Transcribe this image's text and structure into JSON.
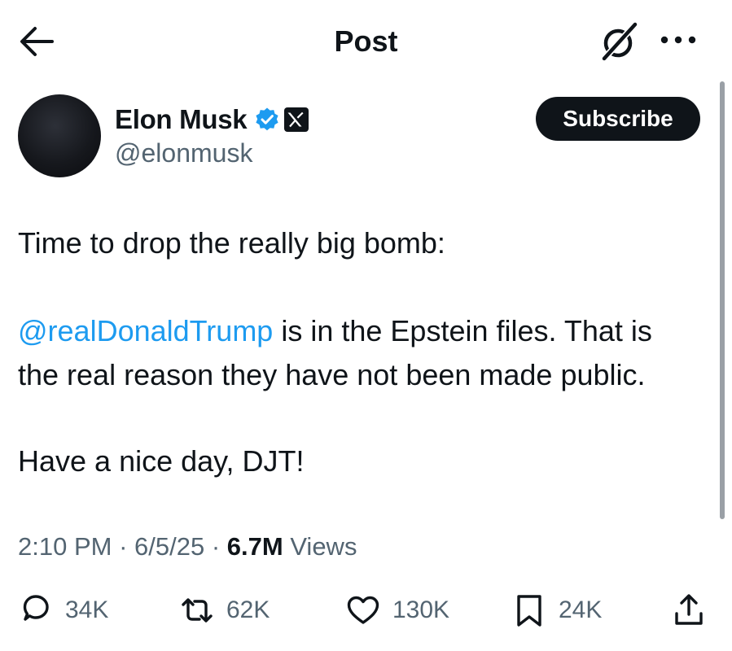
{
  "header": {
    "title": "Post",
    "back_icon": "arrow-left-icon",
    "grok_icon": "grok-icon",
    "more_icon": "more-horizontal-icon"
  },
  "author": {
    "name": "Elon Musk",
    "handle": "@elonmusk",
    "verified_icon": "verified-badge-icon",
    "affiliate_icon": "x-logo-badge-icon",
    "subscribe_label": "Subscribe"
  },
  "post": {
    "line1": "Time to drop the really big bomb:",
    "mention": "@realDonaldTrump",
    "line2_rest": " is in the Epstein files. That is",
    "line3": "the real reason they have not been made public.",
    "line4": "Have a nice day, DJT!"
  },
  "meta": {
    "time": "2:10 PM",
    "sep1": " · ",
    "date": "6/5/25",
    "sep2": " · ",
    "views": "6.7M",
    "views_label": " Views"
  },
  "actions": {
    "replies": "34K",
    "reposts": "62K",
    "likes": "130K",
    "bookmarks": "24K"
  },
  "colors": {
    "text": "#0f1419",
    "secondary": "#536471",
    "accent": "#1d9bf0"
  }
}
